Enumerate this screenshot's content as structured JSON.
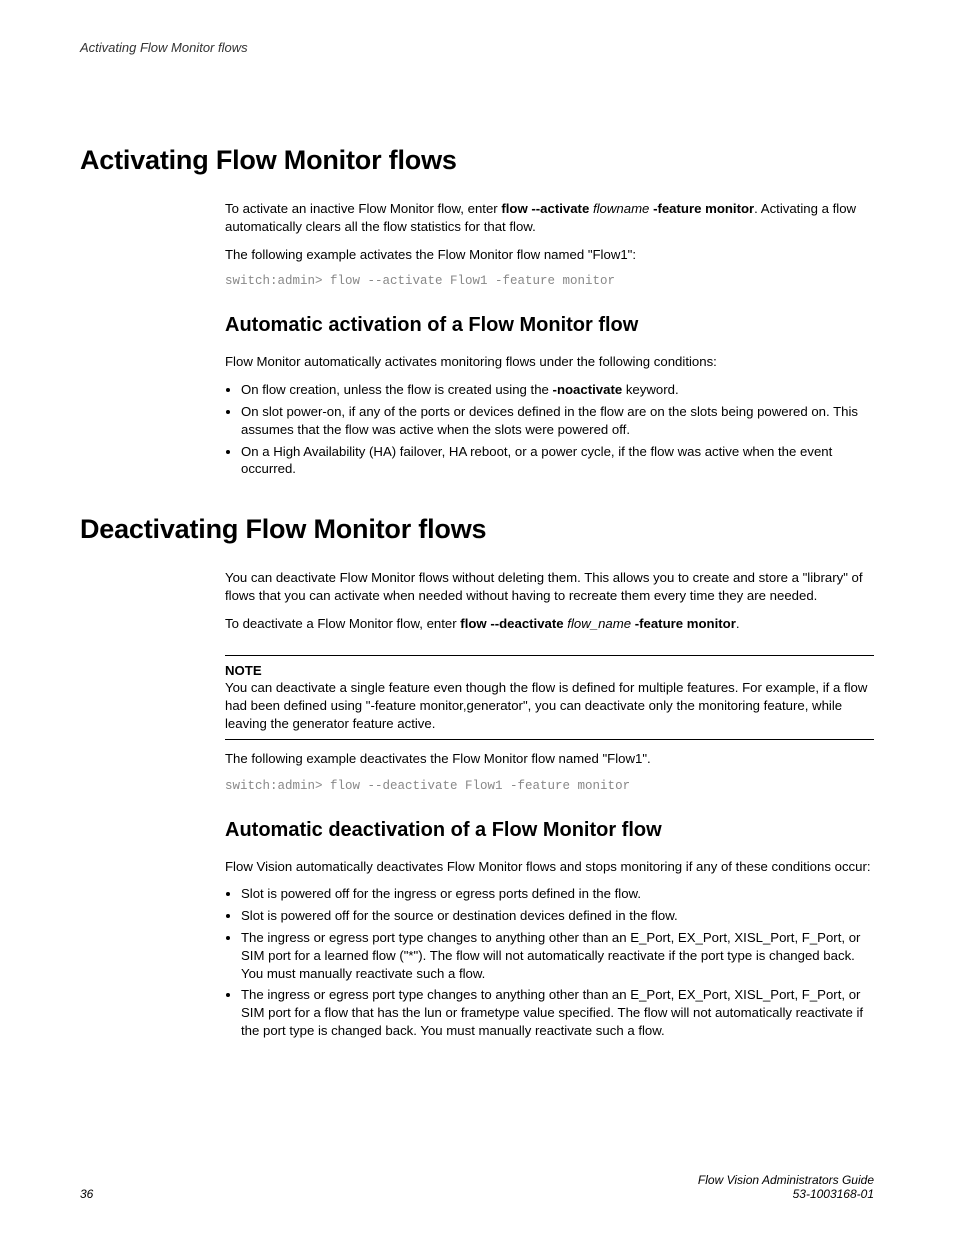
{
  "header": {
    "running": "Activating Flow Monitor flows"
  },
  "s1": {
    "title": "Activating Flow Monitor flows",
    "p1a": "To activate an inactive Flow Monitor flow, enter ",
    "p1b": "flow --activate",
    "p1c": " flowname ",
    "p1d": "-feature monitor",
    "p1e": ". Activating a flow automatically clears all the flow statistics for that flow.",
    "p2": "The following example activates the Flow Monitor flow named \"Flow1\":",
    "code": "switch:admin> flow --activate Flow1 -feature monitor",
    "sub": {
      "title": "Automatic activation of a Flow Monitor flow",
      "intro": "Flow Monitor automatically activates monitoring flows under the following conditions:",
      "b1a": "On flow creation, unless the flow is created using the ",
      "b1b": "-noactivate",
      "b1c": " keyword.",
      "b2": "On slot power-on, if any of the ports or devices defined in the flow are on the slots being powered on. This assumes that the flow was active when the slots were powered off.",
      "b3": "On a High Availability (HA) failover, HA reboot, or a power cycle, if the flow was active when the event occurred."
    }
  },
  "s2": {
    "title": "Deactivating Flow Monitor flows",
    "p1": "You can deactivate Flow Monitor flows without deleting them. This allows you to create and store a \"library\" of flows that you can activate when needed without having to recreate them every time they are needed.",
    "p2a": "To deactivate a Flow Monitor flow, enter ",
    "p2b": "flow --deactivate",
    "p2c": " flow_name ",
    "p2d": "-feature monitor",
    "p2e": ".",
    "note": {
      "label": "NOTE",
      "text": "You can deactivate a single feature even though the flow is defined for multiple features. For example, if a flow had been defined using \"-feature monitor,generator\", you can deactivate only the monitoring feature, while leaving the generator feature active."
    },
    "p3": "The following example deactivates the Flow Monitor flow named \"Flow1\".",
    "code": "switch:admin> flow --deactivate Flow1 -feature monitor",
    "sub": {
      "title": "Automatic deactivation of a Flow Monitor flow",
      "intro": "Flow Vision automatically deactivates Flow Monitor flows and stops monitoring if any of these conditions occur:",
      "b1": "Slot is powered off for the ingress or egress ports defined in the flow.",
      "b2": "Slot is powered off for the source or destination devices defined in the flow.",
      "b3": "The ingress or egress port type changes to anything other than an E_Port, EX_Port, XISL_Port, F_Port, or SIM port for a learned flow (\"*\"). The flow will not automatically reactivate if the port type is changed back. You must manually reactivate such a flow.",
      "b4": "The ingress or egress port type changes to anything other than an E_Port, EX_Port, XISL_Port, F_Port, or SIM port for a flow that has the lun or frametype value specified. The flow will not automatically reactivate if the port type is changed back. You must manually reactivate such a flow."
    }
  },
  "footer": {
    "page": "36",
    "guide": "Flow Vision Administrators Guide",
    "docnum": "53-1003168-01"
  }
}
